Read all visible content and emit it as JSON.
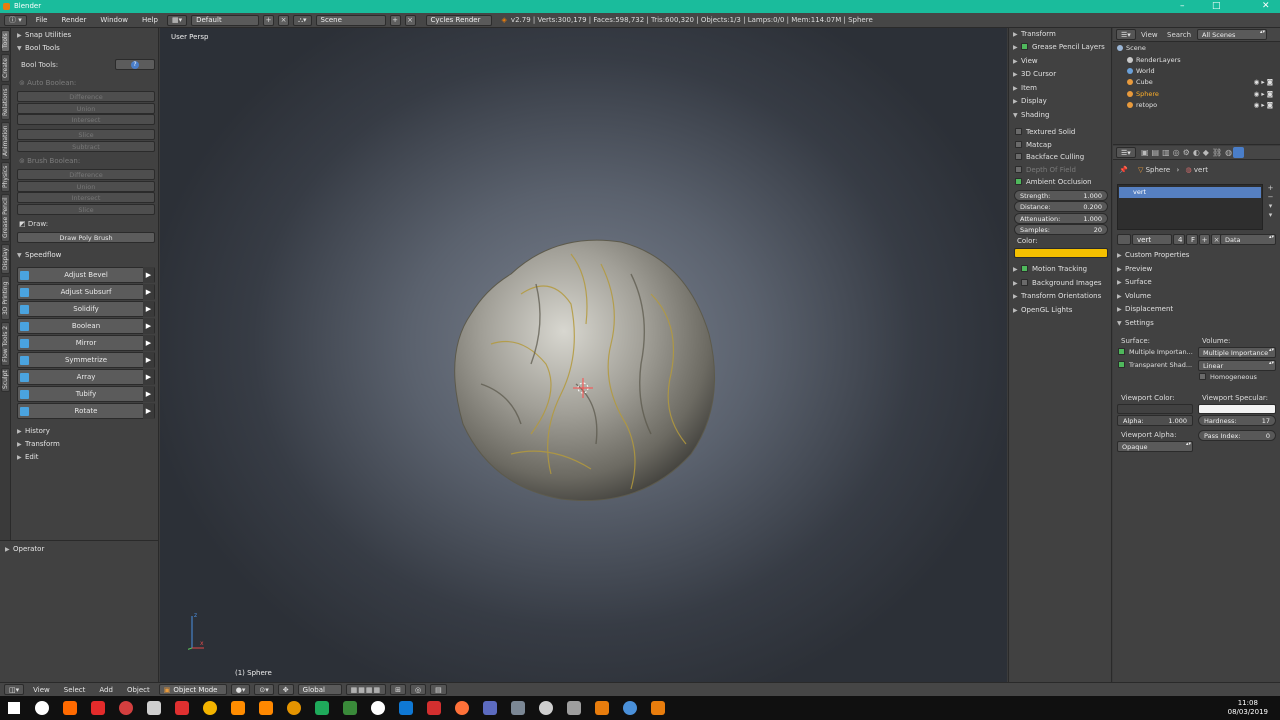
{
  "window": {
    "title": "Blender",
    "minimize": "–",
    "maximize": "□",
    "close": "✕"
  },
  "top_header": {
    "menus": [
      "File",
      "Render",
      "Window",
      "Help"
    ],
    "layout": "Default",
    "scene": "Scene",
    "render_engine": "Cycles Render",
    "stats": "v2.79 | Verts:300,179 | Faces:598,732 | Tris:600,320 | Objects:1/3 | Lamps:0/0 | Mem:114.07M | Sphere"
  },
  "left_tabs": [
    "Tools",
    "Create",
    "Relations",
    "Animation",
    "Physics",
    "Grease Pencil",
    "Display",
    "3D Printing",
    "Flow Tools 2",
    "Sculpt"
  ],
  "toolshelf": {
    "snap_utilities": "Snap Utilities",
    "bool_tools": "Bool Tools",
    "bool_tools_label": "Bool Tools:",
    "help_icon": "?",
    "auto_boolean": "Auto Boolean:",
    "auto_ops": [
      "Difference",
      "Union",
      "Intersect",
      "Slice",
      "Subtract"
    ],
    "brush_boolean": "Brush Boolean:",
    "brush_ops": [
      "Difference",
      "Union",
      "Intersect",
      "Slice"
    ],
    "draw_label": "Draw:",
    "draw_poly": "Draw Poly Brush",
    "speedflow": "Speedflow",
    "speedflow_ops": [
      "Adjust Bevel",
      "Adjust Subsurf",
      "Solidify",
      "Boolean",
      "Mirror",
      "Symmetrize",
      "Array",
      "Tubify",
      "Rotate"
    ],
    "history": "History",
    "transform": "Transform",
    "edit": "Edit",
    "operator": "Operator"
  },
  "viewport": {
    "view_label": "User Persp",
    "object_label": "(1) Sphere",
    "axis_x": "x",
    "axis_z": "z"
  },
  "npanel": {
    "transform": "Transform",
    "grease_pencil_layers": "Grease Pencil Layers",
    "view": "View",
    "cursor": "3D Cursor",
    "item": "Item",
    "display": "Display",
    "shading": "Shading",
    "textured_solid": "Textured Solid",
    "matcap": "Matcap",
    "backface_culling": "Backface Culling",
    "depth_of_field": "Depth Of Field",
    "ambient_occlusion": "Ambient Occlusion",
    "ao_fields": [
      {
        "label": "Strength:",
        "value": "1.000"
      },
      {
        "label": "Distance:",
        "value": "0.200"
      },
      {
        "label": "Attenuation:",
        "value": "1.000"
      },
      {
        "label": "Samples:",
        "value": "20"
      }
    ],
    "color_label": "Color:",
    "ao_color": "#f5c000",
    "motion_tracking": "Motion Tracking",
    "background_images": "Background Images",
    "transform_orientations": "Transform Orientations",
    "opengl_lights": "OpenGL Lights"
  },
  "outliner": {
    "view": "View",
    "search": "Search",
    "filter": "All Scenes",
    "items": [
      {
        "name": "Scene"
      },
      {
        "name": "RenderLayers"
      },
      {
        "name": "World"
      },
      {
        "name": "Cube"
      },
      {
        "name": "Sphere"
      },
      {
        "name": "retopo"
      }
    ]
  },
  "properties": {
    "breadcrumb_object": "Sphere",
    "breadcrumb_material": "vert",
    "slot": "vert",
    "material_name": "vert",
    "users": "4",
    "fake_user": "F",
    "link": "Data",
    "sections": [
      "Custom Properties",
      "Preview",
      "Surface",
      "Volume",
      "Displacement"
    ],
    "settings": "Settings",
    "surface_label": "Surface:",
    "volume_label": "Volume:",
    "multiple_importance": "Multiple Importan...",
    "transparent_shadows": "Transparent Shad...",
    "volume_sampling": "Multiple Importance",
    "interpolation": "Linear",
    "homogeneous": "Homogeneous",
    "viewport_color": "Viewport Color:",
    "viewport_specular": "Viewport Specular:",
    "alpha_label": "Alpha:",
    "alpha_value": "1.000",
    "hardness_label": "Hardness:",
    "hardness_value": "17",
    "viewport_alpha": "Viewport Alpha:",
    "pass_index_label": "Pass Index:",
    "pass_index_value": "0",
    "blend_mode": "Opaque"
  },
  "bottom_header": {
    "menus": [
      "View",
      "Select",
      "Add",
      "Object"
    ],
    "mode": "Object Mode",
    "orientation": "Global"
  },
  "taskbar": {
    "time": "11:08",
    "date": "08/03/2019",
    "apps": [
      "#ffffff",
      "#ff6a00",
      "#e32b2b",
      "#d33f3f",
      "#cfcfcf",
      "#e03030",
      "#f4b400",
      "#ff8c00",
      "#ff8800",
      "#e59400",
      "#1faa5b",
      "#3a8a3a",
      "#ffffff",
      "#0f78d4",
      "#d32f2f",
      "#ff7139",
      "#5c6bc0",
      "#7b8794",
      "#cfcfcf",
      "#9e9e9e",
      "#e87d0d",
      "#4a90d9",
      "#e87d0d"
    ]
  }
}
